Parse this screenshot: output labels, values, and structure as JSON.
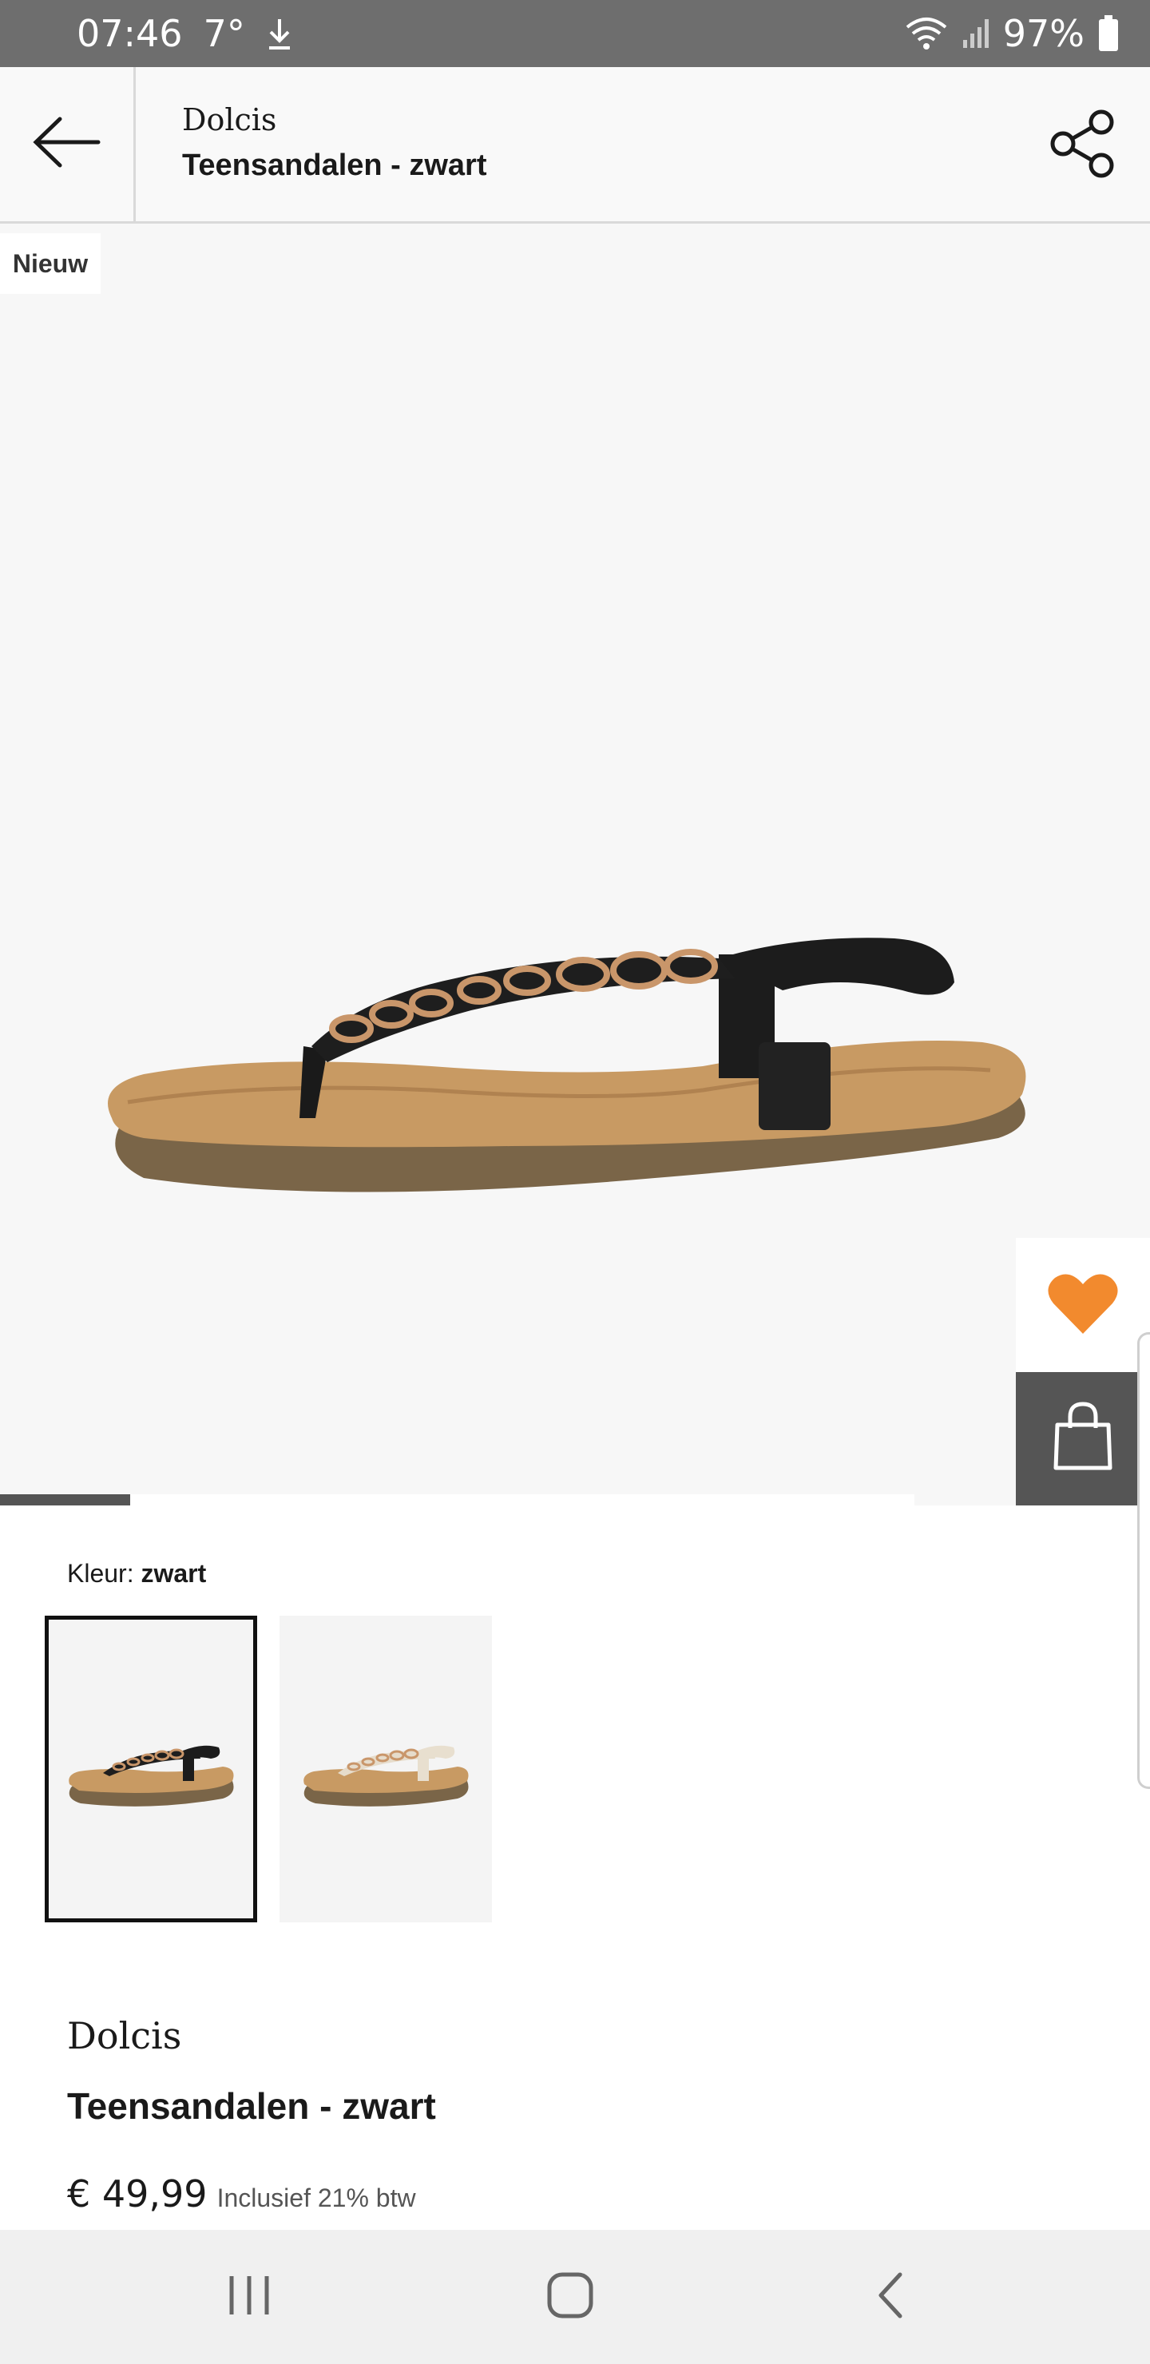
{
  "status": {
    "time": "07:46",
    "temperature": "7°",
    "battery": "97%"
  },
  "header": {
    "brand": "Dolcis",
    "product_title": "Teensandalen - zwart"
  },
  "gallery": {
    "badge": "Nieuw",
    "carousel": {
      "current": 1,
      "total": 7
    }
  },
  "colors": {
    "label": "Kleur:",
    "selected": "zwart",
    "options": [
      {
        "name": "zwart",
        "selected": true
      },
      {
        "name": "beige",
        "selected": false
      }
    ]
  },
  "product": {
    "brand": "Dolcis",
    "name": "Teensandalen - zwart",
    "price": "€ 49,99",
    "vat_note": "Inclusief 21% btw"
  },
  "accent": {
    "favorite": "#f28a2e",
    "dark": "#555555"
  }
}
